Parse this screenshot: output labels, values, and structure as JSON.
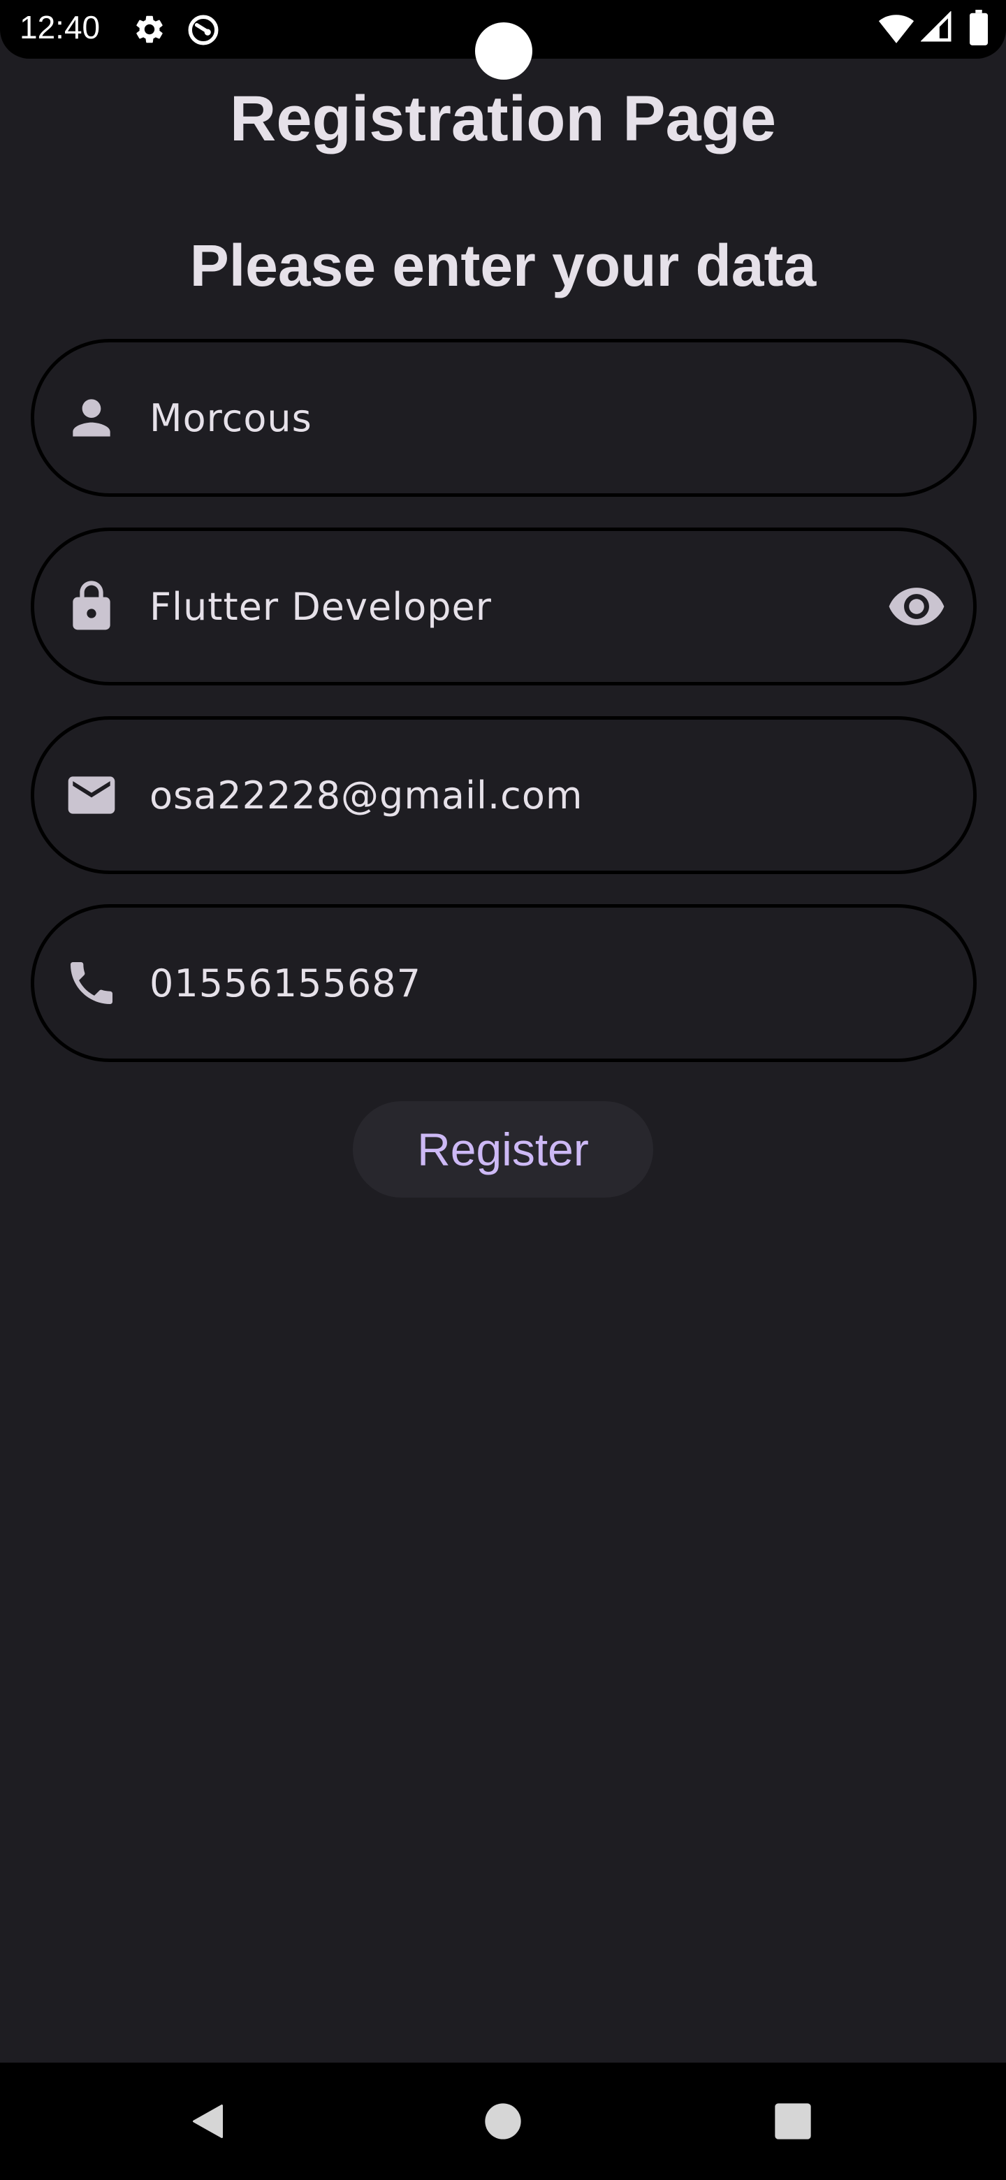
{
  "status_bar": {
    "time": "12:40",
    "icons": [
      "gear-icon",
      "no-signal-circle-icon",
      "wifi-icon",
      "cellular-icon",
      "battery-icon"
    ]
  },
  "page": {
    "title": "Registration Page",
    "subtitle": "Please enter your data"
  },
  "form": {
    "name": {
      "value": "Morcous",
      "icon": "person-icon"
    },
    "password": {
      "value": "Flutter Developer",
      "icon": "lock-icon",
      "toggle_icon": "eye-icon"
    },
    "email": {
      "value": "osa22228@gmail.com",
      "icon": "mail-icon"
    },
    "phone": {
      "value": "01556155687",
      "icon": "phone-icon"
    }
  },
  "register_button": {
    "label": "Register"
  },
  "nav_bar": {
    "items": [
      "back-icon",
      "home-icon",
      "recents-icon"
    ]
  },
  "colors": {
    "background": "#1e1d22",
    "text": "#e6e1e9",
    "icon": "#cac4d0",
    "accent": "#cdb9f5",
    "button_bg": "#28272d"
  }
}
